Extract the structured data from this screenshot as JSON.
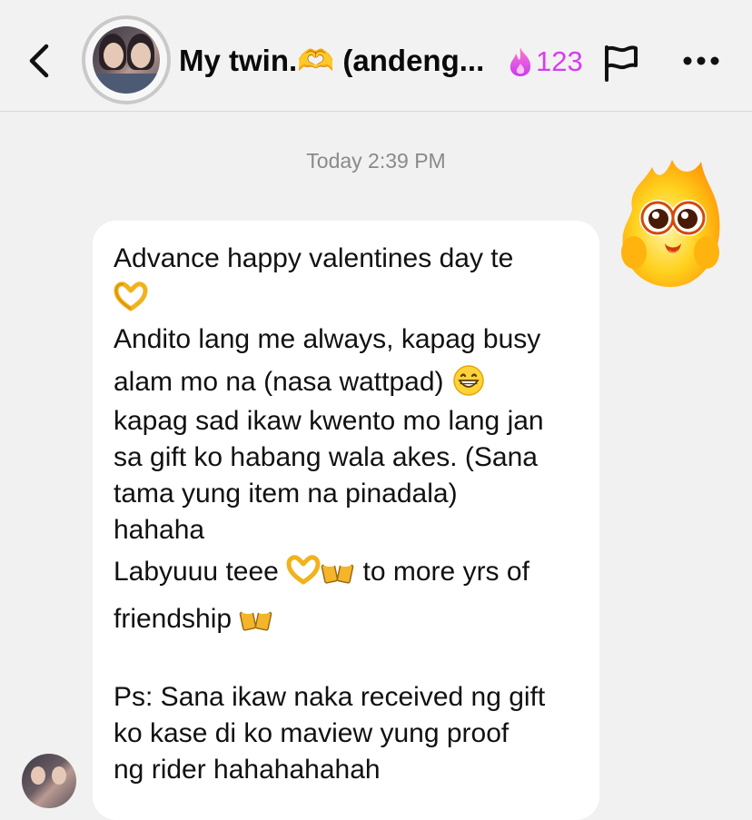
{
  "header": {
    "title": "My twin.🫶 (andeng...",
    "streak_count": "123",
    "back_icon": "chevron-left-icon",
    "streak_icon": "fire-icon",
    "flag_icon": "flag-icon",
    "more_icon": "ellipsis-horizontal-icon"
  },
  "chat": {
    "timestamp": "Today 2:39 PM",
    "sticker": "wide-eyed-flame-sticker",
    "message": {
      "line1": "Advance happy valentines day te",
      "line3": "Andito lang me always, kapag busy",
      "line4": "alam mo na (nasa wattpad)",
      "line5": "kapag sad ikaw kwento mo lang jan",
      "line6": "sa gift ko habang wala akes. (Sana",
      "line7": "tama yung item na pinadala)",
      "line8": "hahaha",
      "line9a": "Labyuuu teee",
      "line9b": "to more yrs of",
      "line10": "friendship",
      "line11": "Ps: Sana ikaw naka received ng gift",
      "line12": "ko kase di ko maview yung proof",
      "line13": "ng rider hahahahahah"
    }
  },
  "colors": {
    "background": "#f1f1f1",
    "bubble": "#ffffff",
    "streak": "#d63df0",
    "timestamp": "#8a8a8a"
  }
}
